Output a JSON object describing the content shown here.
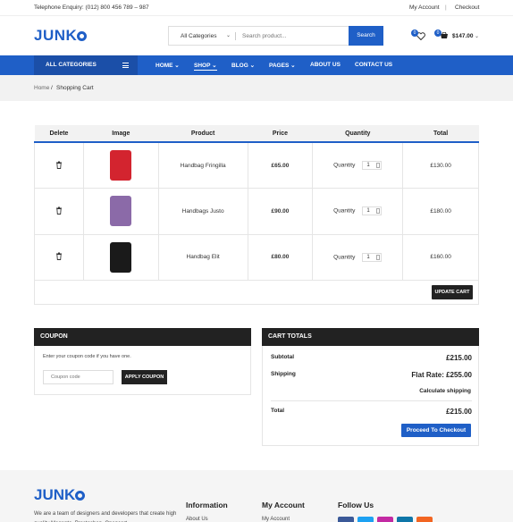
{
  "topbar": {
    "phone": "Telephone Enquiry: (012) 800 456 789 – 987",
    "my_account": "My Account",
    "separator": "|",
    "checkout": "Checkout"
  },
  "header": {
    "logo_pre": "JUNK",
    "logo_post": "",
    "category_select": "All Categories",
    "search_placeholder": "Search product...",
    "search_button": "Search",
    "wishlist_count": "0",
    "cart_count": "0",
    "cart_total": "$147.00"
  },
  "nav": {
    "all_categories": "ALL CATEGORIES",
    "items": [
      {
        "label": "HOME"
      },
      {
        "label": "SHOP"
      },
      {
        "label": "BLOG"
      },
      {
        "label": "PAGES"
      },
      {
        "label": "ABOUT US"
      },
      {
        "label": "CONTACT US"
      }
    ]
  },
  "breadcrumb": {
    "home": "Home",
    "separator": "/",
    "current": "Shopping Cart"
  },
  "cart_table": {
    "headers": [
      "Delete",
      "Image",
      "Product",
      "Price",
      "Quantity",
      "Total"
    ],
    "rows": [
      {
        "product": "Handbag Fringilla",
        "price": "£65.00",
        "qty_label": "Quantity",
        "qty": "1",
        "total": "£130.00",
        "image_color": "#d3242f"
      },
      {
        "product": "Handbags Justo",
        "price": "£90.00",
        "qty_label": "Quantity",
        "qty": "1",
        "total": "£180.00",
        "image_color": "#8b6aa8"
      },
      {
        "product": "Handbag Elit",
        "price": "£80.00",
        "qty_label": "Quantity",
        "qty": "1",
        "total": "£160.00",
        "image_color": "#1a1a1a"
      }
    ],
    "update_button": "UPDATE CART"
  },
  "coupon": {
    "title": "COUPON",
    "text": "Enter your coupon code if you have one.",
    "placeholder": "Coupon code",
    "apply_button": "APPLY COUPON"
  },
  "cart_totals": {
    "title": "CART TOTALS",
    "subtotal_label": "Subtotal",
    "subtotal_value": "£215.00",
    "shipping_label": "Shipping",
    "shipping_value": "Flat Rate:  £255.00",
    "calculate_shipping": "Calculate shipping",
    "total_label": "Total",
    "total_value": "£215.00",
    "proceed_button": "Proceed To Checkout"
  },
  "footer": {
    "logo_pre": "JUNK",
    "description": "We are a team of designers and developers that create high quality Magento, Prestashop, Opencart.",
    "columns": [
      {
        "title": "Information",
        "first_link": "About Us"
      },
      {
        "title": "My Account",
        "first_link": "My Account"
      },
      {
        "title": "Follow Us"
      }
    ],
    "social_colors": [
      "#3b5998",
      "#1da1f2",
      "#c32aa3",
      "#0e76a8",
      "#f26522"
    ]
  },
  "colors": {
    "accent": "#1f5fc7",
    "dark": "#222222"
  }
}
